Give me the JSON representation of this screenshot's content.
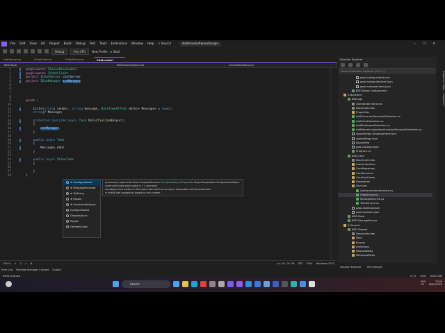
{
  "menu": {
    "items": [
      "File",
      "Edit",
      "View",
      "Git",
      "Project",
      "Build",
      "Debug",
      "Test",
      "Tools",
      "Extensions",
      "Window",
      "Help"
    ],
    "search": "Search",
    "solution": "BeltmanSoftwareDesign"
  },
  "toolbar": {
    "config": "Debug",
    "platform": "Any CPU",
    "profile": "New Profile",
    "start": "Start"
  },
  "tabs": [
    "ChatServer.cs",
    "IChatClient.cs",
    "IChatServer.cs",
    "Chat.razor*"
  ],
  "navbar": {
    "project": "BSD.Razor",
    "class": "BSD.Razor.Pages.Chat",
    "member": "OnInitializedAsync()"
  },
  "code": [
    [
      [
        "@implements ",
        "dir"
      ],
      [
        "IAsyncDisposable",
        "ty"
      ]
    ],
    [
      [
        "@implements ",
        "dir"
      ],
      [
        "IChatClient",
        "ty"
      ]
    ],
    [
      [
        "@inject ",
        "dir"
      ],
      [
        "IChatServer ",
        "ty"
      ],
      [
        "chatServer",
        "id"
      ]
    ],
    [
      [
        "@inject ",
        "dir"
      ],
      [
        "ISseManager ",
        "ty"
      ],
      [
        "sseManager",
        "sel"
      ]
    ],
    [],
    [],
    [],
    [],
    [
      [
        "@code {",
        "dir"
      ]
    ],
    [],
    [
      [
        "    List<(",
        "pl"
      ],
      [
        "string ",
        "kw"
      ],
      [
        "sender, ",
        "pl"
      ],
      [
        "string ",
        "kw"
      ],
      [
        "message, ",
        "pl"
      ],
      [
        "DateTimeOffset ",
        "ty"
      ],
      [
        "date)> Messages = ",
        "pl"
      ],
      [
        "new",
        "kw"
      ],
      [
        "();",
        "pl"
      ]
    ],
    [
      [
        "    string",
        "kw"
      ],
      [
        "? Message;",
        "pl"
      ]
    ],
    [],
    [
      [
        "    protected override async ",
        "kw"
      ],
      [
        "Task ",
        "ty"
      ],
      [
        "OnInitializedAsync",
        "fn"
      ],
      [
        "()",
        "pl"
      ]
    ],
    [
      [
        "    {",
        "pl"
      ]
    ],
    [
      [
        "        ",
        "pl"
      ],
      [
        "sseManager",
        "sel"
      ],
      [
        ".",
        "pl"
      ]
    ],
    [
      [
        "    }",
        "pl"
      ]
    ],
    [],
    [
      [
        "    public async ",
        "kw"
      ],
      [
        "Task",
        "ty"
      ]
    ],
    [
      [
        "    {",
        "pl"
      ]
    ],
    [
      [
        "        Messages.Add(",
        "pl"
      ]
    ],
    [
      [
        "    }",
        "pl"
      ]
    ],
    [],
    [
      [
        "    public async ",
        "kw"
      ],
      [
        "ValueTask",
        "ty"
      ]
    ],
    [
      [
        "    {",
        "pl"
      ]
    ],
    [],
    [
      [
        "    }",
        "pl"
      ]
    ],
    [
      [
        "}",
        "pl"
      ]
    ]
  ],
  "autocomplete": [
    {
      "label": "★ ConfigureAwait",
      "selected": true
    },
    {
      "label": "★ MessageReceived"
    },
    {
      "label": "★ TolString"
    },
    {
      "label": "★ Equals"
    },
    {
      "label": "★ UnsubscribeAsync"
    },
    {
      "label": "ConfigureAwait"
    },
    {
      "label": "DisposeAsync"
    },
    {
      "label": "Equals"
    },
    {
      "label": "GetHashCode"
    }
  ],
  "tooltip": {
    "signature_prefix": "(extension) System.Runtime.CompilerServices.",
    "signature_type": "ConfiguredAsyncDisposable",
    "signature_rest": " IAsyncDisposable.ConfigureAwait(bool continueOnCapturedContext) (+ 1 overload)",
    "description": "Configures how awaits on the tasks returned from an async disposable will be performed.",
    "note": "★ IntelliCode suggestion based on this context"
  },
  "editor_status": {
    "zoom": "100 %",
    "errors": "2",
    "warnings": "8",
    "position": "Ln: 16, Ch: 28",
    "spc": "SPC",
    "crlf": "CRLF",
    "encoding": "Windows 1252"
  },
  "bottom_tabs": [
    "Error List",
    "Package Manager Console",
    "Output"
  ],
  "status": {
    "message": "Item(s) Saved",
    "lines": "0 / 0",
    "branch": "main",
    "repo": "BSD-CRM"
  },
  "solution_explorer": {
    "title": "Solution Explorer",
    "search_placeholder": "Search Solution Explorer (Ctrl+;)",
    "tabs": [
      "Solution Explorer",
      "Git Changes"
    ],
    "items": [
      {
        "label": "gapi.autoapiclient.json",
        "icon": "file",
        "level": 4
      },
      {
        "label": "gapi.autobuildclient.json",
        "icon": "file",
        "level": 4
      },
      {
        "label": "gapi.autoseeclient.json",
        "icon": "file",
        "level": 4
      },
      {
        "label": "BSD.Razor.Components",
        "icon": "proj",
        "level": 3
      },
      {
        "label": "2.Backend",
        "icon": "folder",
        "level": 1
      },
      {
        "label": "BSD.Api",
        "icon": "proj",
        "level": 2
      },
      {
        "label": "Connected Services",
        "icon": "dep",
        "level": 3
      },
      {
        "label": "Dependencies",
        "icon": "dep",
        "level": 3
      },
      {
        "label": "Properties",
        "icon": "folder",
        "level": 3
      },
      {
        "label": "AddCommonServicesExtention.cs",
        "icon": "cs",
        "level": 3
      },
      {
        "label": "AddCoreExtention.cs",
        "icon": "cs",
        "level": 3
      },
      {
        "label": "AddDatabaseExtention.cs",
        "icon": "cs",
        "level": 3
      },
      {
        "label": "AddRemainingAuthenticationServicesExtention.cs",
        "icon": "cs",
        "level": 3
      },
      {
        "label": "appsettings.Development.json",
        "icon": "file",
        "level": 3
      },
      {
        "label": "appsettings.json",
        "icon": "file",
        "level": 3
      },
      {
        "label": "Dockerfile",
        "icon": "file",
        "level": 3
      },
      {
        "label": "gapi.autoapi.json",
        "icon": "file",
        "level": 3
      },
      {
        "label": "Program.cs",
        "icon": "cs",
        "level": 3
      },
      {
        "label": "BSD.Core",
        "icon": "proj",
        "level": 2
      },
      {
        "label": "Dependencies",
        "icon": "dep",
        "level": 3
      },
      {
        "label": "Authentication",
        "icon": "folder",
        "level": 3
      },
      {
        "label": "CoreMappings",
        "icon": "folder",
        "level": 3
      },
      {
        "label": "CoreServices",
        "icon": "folder",
        "level": 3
      },
      {
        "label": "CoreUseCases",
        "icon": "folder",
        "level": 3
      },
      {
        "label": "Extentions",
        "icon": "folder",
        "level": 3
      },
      {
        "label": "Services",
        "icon": "folder",
        "level": 3
      },
      {
        "label": "AuthenticationService.cs",
        "icon": "cs",
        "level": 4
      },
      {
        "label": "ChatServer.cs",
        "icon": "cs",
        "level": 4,
        "selected": true
      },
      {
        "label": "ManageService.cs",
        "icon": "cs",
        "level": 4
      },
      {
        "label": "TextService.cs",
        "icon": "cs",
        "level": 4
      },
      {
        "label": "gapi.autohub.json",
        "icon": "file",
        "level": 3
      },
      {
        "label": "gapi.autosee.json",
        "icon": "file",
        "level": 3
      },
      {
        "label": "BSD.Data",
        "icon": "proj",
        "level": 2
      },
      {
        "label": "BSD.StorageServer",
        "icon": "proj",
        "level": 2
      },
      {
        "label": "3.Shared",
        "icon": "folder",
        "level": 1
      },
      {
        "label": "BSD.Shared",
        "icon": "proj",
        "level": 2
      },
      {
        "label": "Dependencies",
        "icon": "dep",
        "level": 3
      },
      {
        "label": "Dtos",
        "icon": "folder",
        "level": 3
      },
      {
        "label": "Enums",
        "icon": "folder",
        "level": 3
      },
      {
        "label": "Interfaces",
        "icon": "folder",
        "level": 3
      },
      {
        "label": "RequestDtos",
        "icon": "folder",
        "level": 3
      },
      {
        "label": "ResponseDtos",
        "icon": "folder",
        "level": 3
      }
    ]
  },
  "right_strip": [
    "Diagnostic Tools",
    "Properties"
  ],
  "taskbar": {
    "search": "Search",
    "lang": "ENG",
    "region": "US",
    "time": "23:08",
    "date": "18/01/2026",
    "icon_colors": [
      "#4aa3f0",
      "#e8c04a",
      "#1fa2e0",
      "#e34133",
      "#888",
      "#aaa",
      "#7b5cf0",
      "#8b5cf6",
      "#2f8ee0",
      "#3b7bdc",
      "#6fa0d8",
      "#3b5fc0",
      "#555",
      "#29b6a8",
      "#4a90e2",
      "#ddd"
    ]
  }
}
